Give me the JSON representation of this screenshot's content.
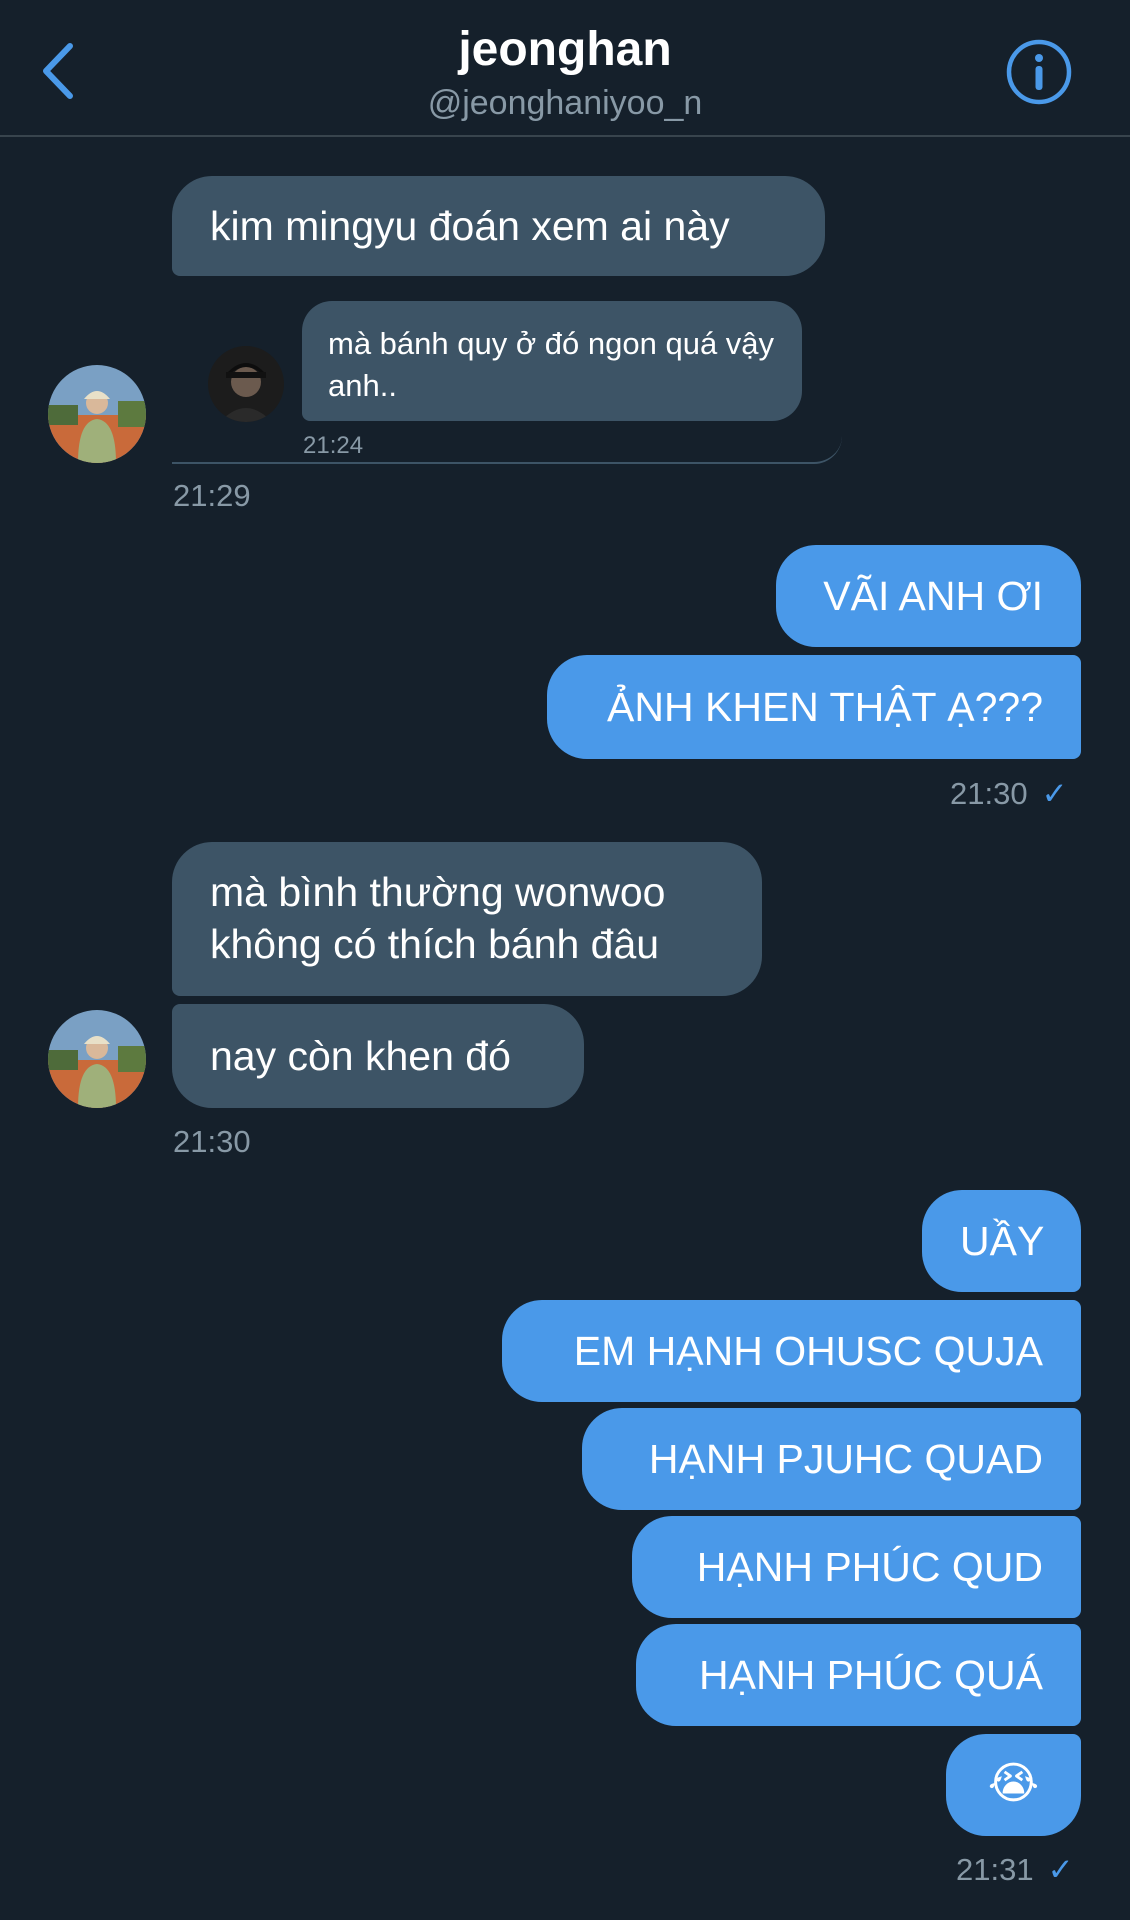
{
  "header": {
    "title": "jeonghan",
    "handle": "@jeonghaniyoo_n",
    "back_icon": "chevron-left-icon",
    "info_icon": "info-circle-icon"
  },
  "colors": {
    "background": "#15202b",
    "incoming_bubble": "#3d5466",
    "outgoing_bubble": "#4a99e9",
    "muted_text": "#8899a6",
    "divider": "#38444d"
  },
  "messages": {
    "m1": "kim mingyu đoán xem ai này",
    "quoted": {
      "text": "mà bánh quy ở đó ngon quá vậy anh..",
      "time": "21:24"
    },
    "g1_time": "21:29",
    "m2": "VÃI ANH ƠI",
    "m3": "ẢNH KHEN THẬT Ạ???",
    "g2_time": "21:30",
    "m4_line1": "mà bình thường wonwoo",
    "m4_line2": "không có thích bánh đâu",
    "m5": "nay còn khen đó",
    "g3_time": "21:30",
    "m6": "UẦY",
    "m7": "EM HẠNH OHUSC QUJA",
    "m8": "HẠNH PJUHC QUAD",
    "m9": "HẠNH PHÚC QUD",
    "m10": "HẠNH PHÚC QUÁ",
    "m11": "😭",
    "g4_time": "21:31"
  },
  "status": {
    "read_icon": "checkmark-icon",
    "check_glyph": "✓"
  }
}
